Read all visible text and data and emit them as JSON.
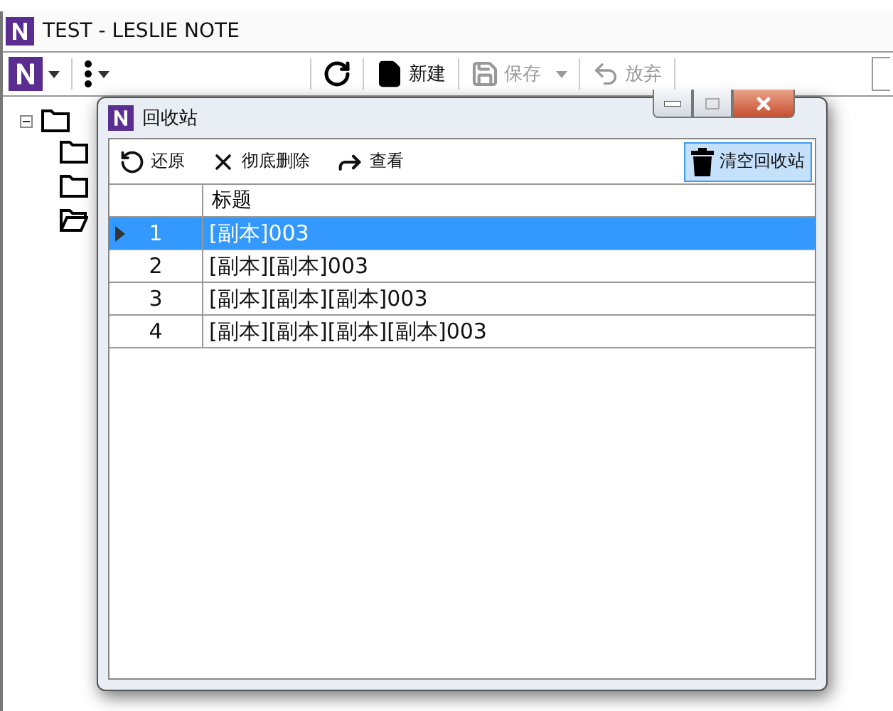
{
  "main_window": {
    "title": "TEST - LESLIE NOTE",
    "toolbar": [
      {
        "kind": "refresh",
        "disabled": false
      },
      {
        "kind": "new",
        "label": "新建",
        "disabled": false
      },
      {
        "kind": "save",
        "label": "保存",
        "disabled": true
      },
      {
        "kind": "discard",
        "label": "放弃",
        "disabled": true
      }
    ],
    "tree": [
      {
        "expanded": true,
        "children": [
          {
            "kind": "folder"
          },
          {
            "kind": "folder"
          },
          {
            "kind": "open-folder"
          }
        ]
      }
    ]
  },
  "dialog": {
    "title": "回收站",
    "toolbar": [
      {
        "kind": "restore",
        "label": "还原",
        "hovered": false
      },
      {
        "kind": "delete",
        "label": "彻底删除",
        "hovered": false
      },
      {
        "kind": "view",
        "label": "查看",
        "hovered": false
      },
      {
        "kind": "empty",
        "label": "清空回收站",
        "hovered": true
      }
    ],
    "table": {
      "columns": [
        "标题"
      ],
      "rows": [
        {
          "index": "1",
          "title": "[副本]003",
          "selected": true
        },
        {
          "index": "2",
          "title": "[副本][副本]003",
          "selected": false
        },
        {
          "index": "3",
          "title": "[副本][副本][副本]003",
          "selected": false
        },
        {
          "index": "4",
          "title": "[副本][副本][副本][副本]003",
          "selected": false
        }
      ]
    }
  }
}
